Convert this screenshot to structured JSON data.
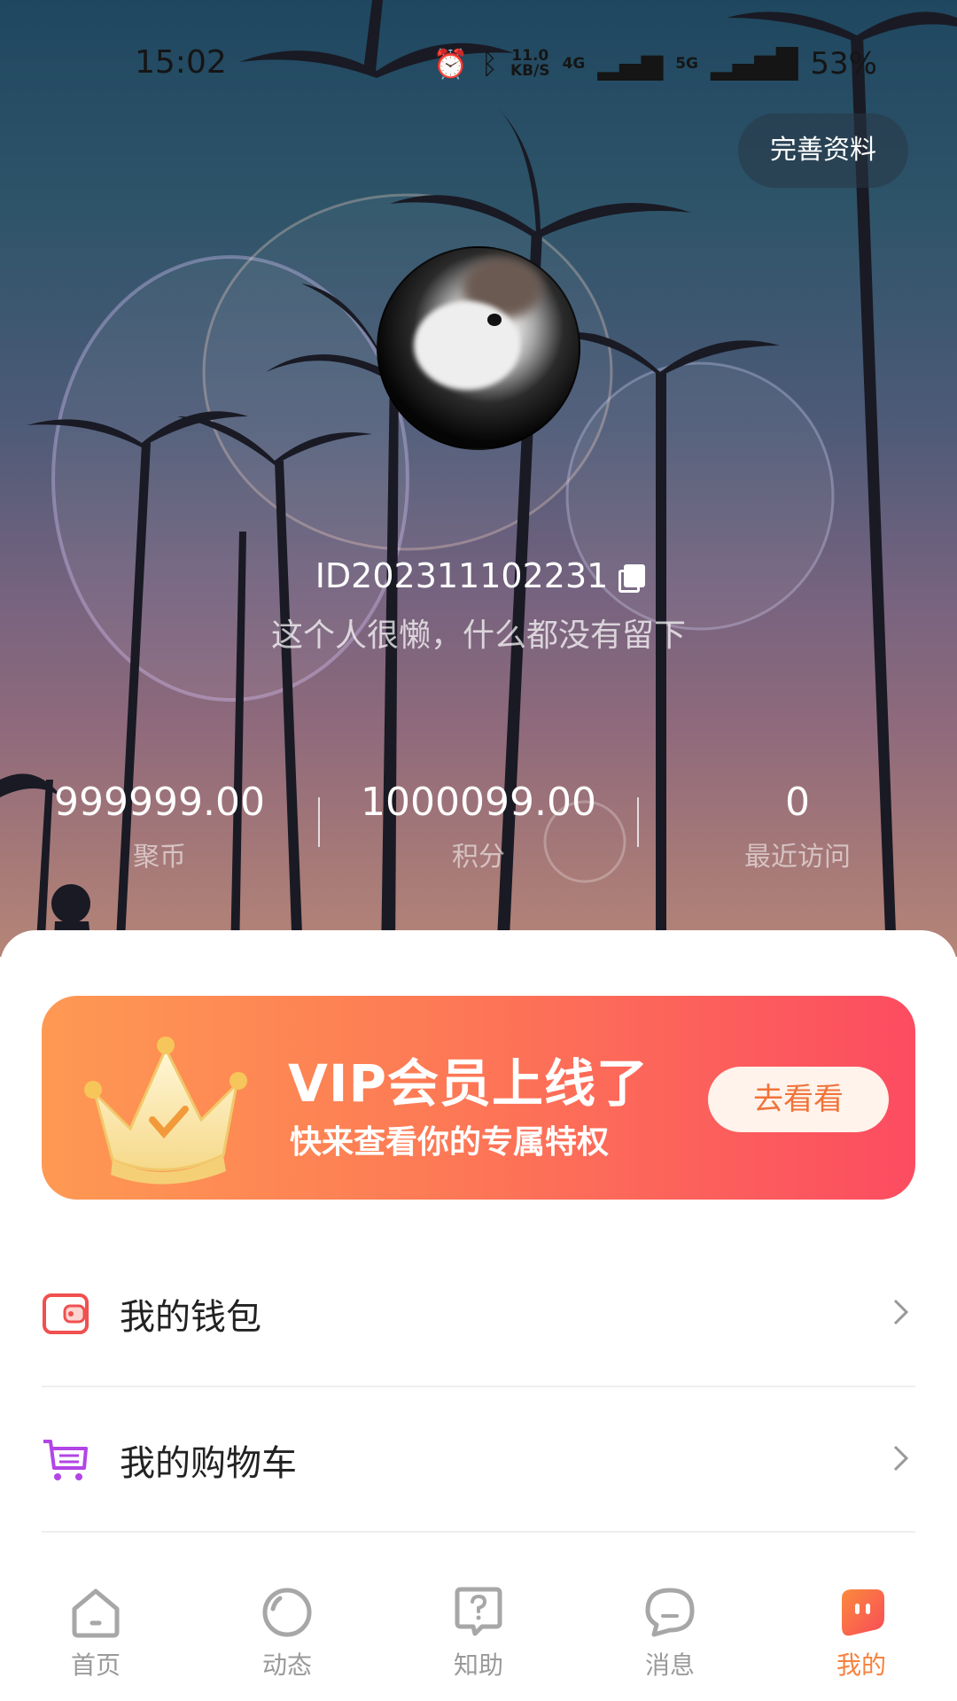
{
  "status_bar": {
    "time": "15:02",
    "net_speed_value": "11.0",
    "net_speed_unit": "KB/S",
    "network_4g": "4G",
    "network_5g": "5G",
    "battery": "53%"
  },
  "header": {
    "edit_profile_label": "完善资料"
  },
  "profile": {
    "user_id": "ID202311102231",
    "bio": "这个人很懒，什么都没有留下"
  },
  "stats": [
    {
      "value": "999999.00",
      "label": "聚币"
    },
    {
      "value": "1000099.00",
      "label": "积分"
    },
    {
      "value": "0",
      "label": "最近访问"
    }
  ],
  "vip_banner": {
    "title": "VIP会员上线了",
    "subtitle": "快来查看你的专属特权",
    "button_label": "去看看",
    "gradient_start": "#fe9953",
    "gradient_end": "#fc4c61"
  },
  "menu": [
    {
      "label": "我的钱包",
      "icon": "wallet-icon",
      "color": "#f0504f"
    },
    {
      "label": "我的购物车",
      "icon": "shopping-cart-icon",
      "color": "#b345e6"
    }
  ],
  "tabs": [
    {
      "label": "首页",
      "icon": "home-icon",
      "active": false
    },
    {
      "label": "动态",
      "icon": "moments-icon",
      "active": false
    },
    {
      "label": "知助",
      "icon": "question-icon",
      "active": false
    },
    {
      "label": "消息",
      "icon": "message-icon",
      "active": false
    },
    {
      "label": "我的",
      "icon": "profile-icon",
      "active": true
    }
  ],
  "colors": {
    "accent": "#f7823e",
    "tab_inactive": "#9a9a9a"
  }
}
